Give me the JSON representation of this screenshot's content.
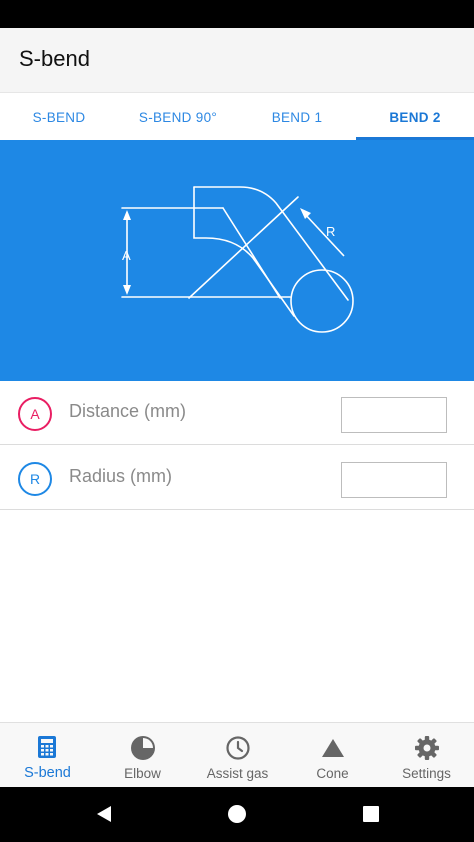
{
  "app": {
    "title": "S-bend"
  },
  "tabs": [
    {
      "label": "S-BEND",
      "active": false
    },
    {
      "label": "S-BEND 90°",
      "active": false
    },
    {
      "label": "BEND 1",
      "active": false
    },
    {
      "label": "BEND 2",
      "active": true
    }
  ],
  "diagram": {
    "label_a": "A",
    "label_r": "R"
  },
  "inputs": {
    "distance": {
      "badge": "A",
      "label": "Distance (mm)",
      "value": "",
      "badge_color": "#e91e63"
    },
    "radius": {
      "badge": "R",
      "label": "Radius (mm)",
      "value": "",
      "badge_color": "#1e88e5"
    }
  },
  "bottom_nav": [
    {
      "label": "S-bend",
      "icon": "calculator-icon",
      "active": true
    },
    {
      "label": "Elbow",
      "icon": "pie-chart-icon",
      "active": false
    },
    {
      "label": "Assist gas",
      "icon": "clock-icon",
      "active": false
    },
    {
      "label": "Cone",
      "icon": "triangle-icon",
      "active": false
    },
    {
      "label": "Settings",
      "icon": "gear-icon",
      "active": false
    }
  ],
  "colors": {
    "accent": "#1e88e5",
    "diagram_bg": "#1e88e5",
    "badge_a": "#e91e63"
  }
}
